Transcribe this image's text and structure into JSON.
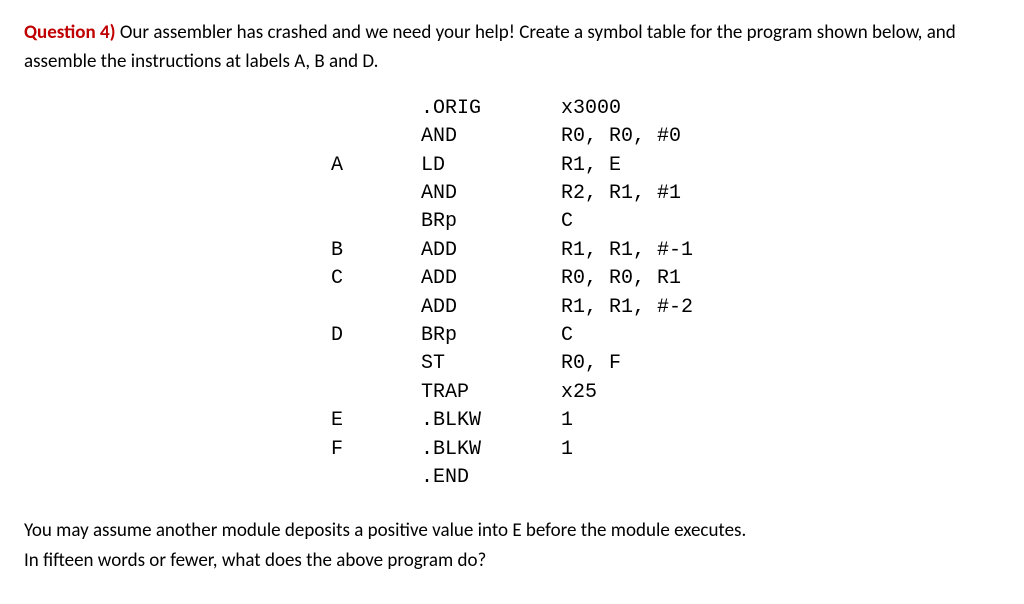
{
  "question": {
    "number": "Question 4)",
    "intro": " Our assembler has crashed and we need your help! Create a symbol table for the program shown below, and assemble the instructions at labels A, B and D."
  },
  "code": {
    "lines": [
      {
        "label": "",
        "op": ".ORIG",
        "args": "x3000"
      },
      {
        "label": "",
        "op": "AND",
        "args": "R0, R0, #0"
      },
      {
        "label": "A",
        "op": "LD",
        "args": "R1, E"
      },
      {
        "label": "",
        "op": "AND",
        "args": "R2, R1, #1"
      },
      {
        "label": "",
        "op": "BRp",
        "args": "C"
      },
      {
        "label": "B",
        "op": "ADD",
        "args": "R1, R1, #-1"
      },
      {
        "label": "C",
        "op": "ADD",
        "args": "R0, R0, R1"
      },
      {
        "label": "",
        "op": "ADD",
        "args": "R1, R1, #-2"
      },
      {
        "label": "D",
        "op": "BRp",
        "args": "C"
      },
      {
        "label": "",
        "op": "ST",
        "args": "R0, F"
      },
      {
        "label": "",
        "op": "TRAP",
        "args": "x25"
      },
      {
        "label": "E",
        "op": ".BLKW",
        "args": "1"
      },
      {
        "label": "F",
        "op": ".BLKW",
        "args": "1"
      },
      {
        "label": "",
        "op": ".END",
        "args": ""
      }
    ]
  },
  "footer": {
    "line1": "You may assume another module deposits a positive value into E before the module executes.",
    "line2": "In fifteen words or fewer, what does the above program do?"
  }
}
